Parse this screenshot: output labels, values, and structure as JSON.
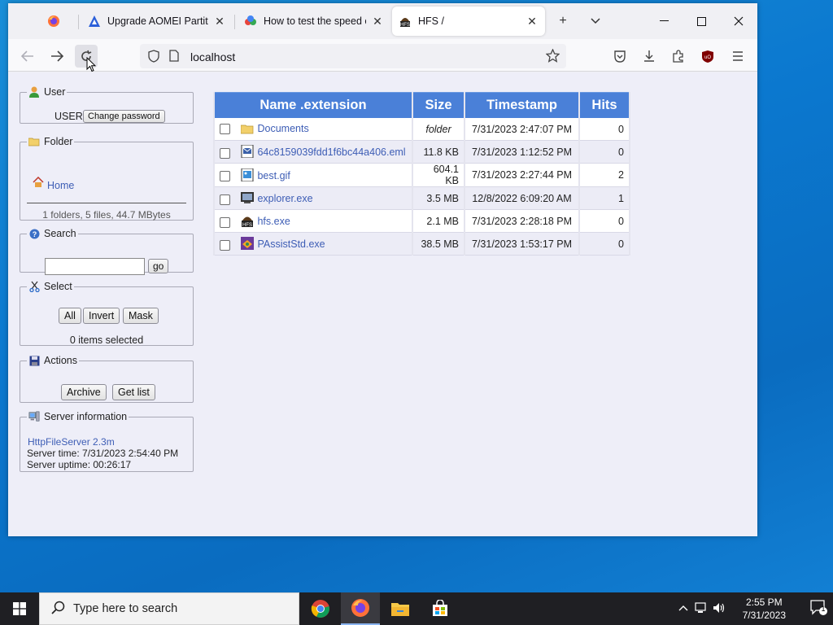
{
  "browser": {
    "tabs": [
      {
        "label": "",
        "icon": "firefox-icon"
      },
      {
        "label": "Upgrade AOMEI Partition",
        "icon": "aomei-icon"
      },
      {
        "label": "How to test the speed of",
        "icon": "speedtest-icon"
      },
      {
        "label": "HFS /",
        "icon": "hfs-icon"
      }
    ],
    "url": "localhost"
  },
  "user_panel": {
    "legend": "User",
    "username": "USER",
    "change_password_label": "Change password"
  },
  "folder_panel": {
    "legend": "Folder",
    "home_label": "Home",
    "summary": "1 folders, 5 files, 44.7 MBytes"
  },
  "search_panel": {
    "legend": "Search",
    "query": "",
    "go_label": "go"
  },
  "select_panel": {
    "legend": "Select",
    "all_label": "All",
    "invert_label": "Invert",
    "mask_label": "Mask",
    "selected_text": "0 items selected"
  },
  "actions_panel": {
    "legend": "Actions",
    "archive_label": "Archive",
    "get_list_label": "Get list"
  },
  "server_panel": {
    "legend": "Server information",
    "software": "HttpFileServer 2.3m",
    "server_time": "Server time: 7/31/2023 2:54:40 PM",
    "server_uptime": "Server uptime: 00:26:17"
  },
  "file_table": {
    "headers": {
      "name": "Name .extension",
      "size": "Size",
      "timestamp": "Timestamp",
      "hits": "Hits"
    },
    "rows": [
      {
        "name": "Documents",
        "size": "folder",
        "timestamp": "7/31/2023 2:47:07 PM",
        "hits": "0",
        "icon": "folder-icon"
      },
      {
        "name": "64c8159039fdd1f6bc44a406.eml",
        "size": "11.8 KB",
        "timestamp": "7/31/2023 1:12:52 PM",
        "hits": "0",
        "icon": "email-file-icon"
      },
      {
        "name": "best.gif",
        "size": "604.1 KB",
        "timestamp": "7/31/2023 2:27:44 PM",
        "hits": "2",
        "icon": "image-file-icon"
      },
      {
        "name": "explorer.exe",
        "size": "3.5 MB",
        "timestamp": "12/8/2022 6:09:20 AM",
        "hits": "1",
        "icon": "explorer-file-icon"
      },
      {
        "name": "hfs.exe",
        "size": "2.1 MB",
        "timestamp": "7/31/2023 2:28:18 PM",
        "hits": "0",
        "icon": "hfs-file-icon"
      },
      {
        "name": "PAssistStd.exe",
        "size": "38.5 MB",
        "timestamp": "7/31/2023 1:53:17 PM",
        "hits": "0",
        "icon": "paassist-file-icon"
      }
    ]
  },
  "taskbar": {
    "search_placeholder": "Type here to search",
    "time": "2:55 PM",
    "date": "7/31/2023",
    "notification_count": "1"
  },
  "colors": {
    "table_header": "#4a80d8",
    "link": "#3d5db5",
    "page_bg": "#eeeef8"
  }
}
